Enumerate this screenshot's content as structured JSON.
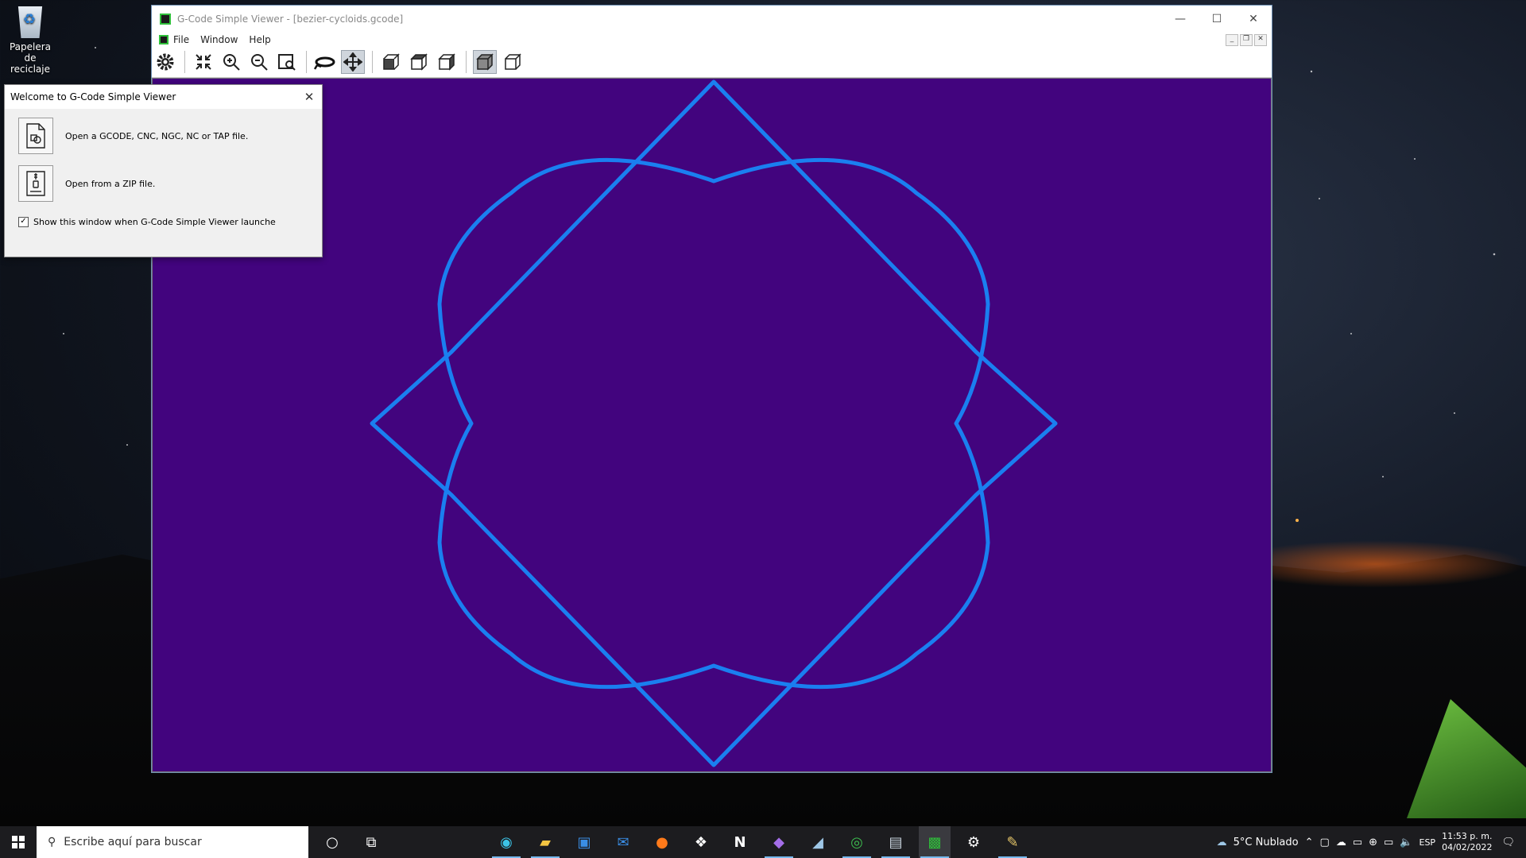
{
  "desktop": {
    "recycle_bin_label": "Papelera de reciclaje"
  },
  "app": {
    "title": "G-Code Simple Viewer - [bezier-cycloids.gcode]",
    "menu": [
      {
        "label": "File"
      },
      {
        "label": "Window"
      },
      {
        "label": "Help"
      }
    ],
    "toolbar": [
      {
        "icon": "gear-icon"
      },
      {
        "icon": "zoom-extents-icon"
      },
      {
        "icon": "zoom-in-icon"
      },
      {
        "icon": "zoom-out-icon"
      },
      {
        "icon": "zoom-window-icon"
      },
      {
        "icon": "rotate-icon"
      },
      {
        "icon": "pan-icon"
      },
      {
        "icon": "front-view-icon"
      },
      {
        "icon": "side-view-icon"
      },
      {
        "icon": "top-view-icon"
      },
      {
        "icon": "shaded-view-icon"
      },
      {
        "icon": "wireframe-view-icon"
      }
    ],
    "viewport_color": "#42047e",
    "path_color": "#1a7ff0"
  },
  "dialog": {
    "title": "Welcome to G-Code Simple Viewer",
    "open_gcode_label": "Open a GCODE, CNC, NGC, NC or TAP file.",
    "open_zip_label": "Open from a ZIP file.",
    "show_on_launch_label": "Show this window when G-Code Simple Viewer launche",
    "show_on_launch_checked": true
  },
  "taskbar": {
    "search_placeholder": "Escribe aquí para buscar",
    "weather": "5°C  Nublado",
    "language": "ESP",
    "time": "11:53 p. m.",
    "date": "04/02/2022"
  }
}
